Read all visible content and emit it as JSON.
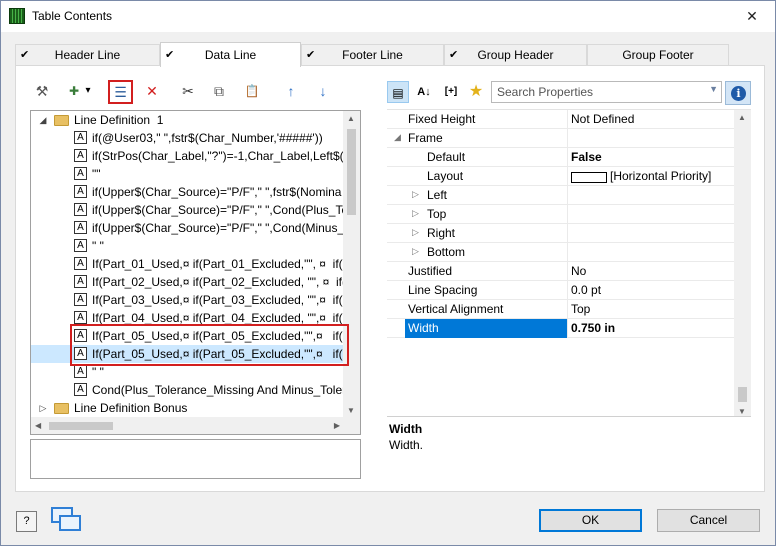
{
  "window": {
    "title": "Table Contents",
    "close_glyph": "✕"
  },
  "tabs": [
    {
      "label": "Header Line",
      "checked": true
    },
    {
      "label": "Data Line",
      "checked": true,
      "active": true
    },
    {
      "label": "Footer Line",
      "checked": true
    },
    {
      "label": "Group Header",
      "checked": true
    },
    {
      "label": "Group Footer",
      "checked": false
    }
  ],
  "check_glyph": "✔",
  "left_toolbar": [
    {
      "name": "wizard-icon",
      "glyph": "⚒"
    },
    {
      "name": "new-item-icon",
      "glyph": "✚"
    },
    {
      "name": "dropdown-arrow-icon",
      "glyph": "▾"
    },
    {
      "name": "edit-properties-icon",
      "glyph": "☰"
    },
    {
      "name": "delete-icon",
      "glyph": "✕"
    },
    {
      "name": "cut-icon",
      "glyph": "✂"
    },
    {
      "name": "copy-icon",
      "glyph": "⧉"
    },
    {
      "name": "paste-icon",
      "glyph": "📋"
    },
    {
      "name": "move-up-icon",
      "glyph": "↑"
    },
    {
      "name": "move-down-icon",
      "glyph": "↓"
    }
  ],
  "tree": {
    "items": [
      {
        "kind": "folder",
        "text": "Line Definition  1",
        "expanded": true
      },
      {
        "kind": "field",
        "text": "if(@User03,\" \",fstr$(Char_Number,'#####'))"
      },
      {
        "kind": "field",
        "text": "if(StrPos(Char_Label,\"?\")=-1,Char_Label,Left$(C"
      },
      {
        "kind": "field",
        "text": "\"\""
      },
      {
        "kind": "field",
        "text": "if(Upper$(Char_Source)=\"P/F\",\" \",fstr$(Nomina"
      },
      {
        "kind": "field",
        "text": "if(Upper$(Char_Source)=\"P/F\",\" \",Cond(Plus_To"
      },
      {
        "kind": "field",
        "text": "if(Upper$(Char_Source)=\"P/F\",\" \",Cond(Minus_"
      },
      {
        "kind": "field",
        "text": "\" \""
      },
      {
        "kind": "field",
        "text": "If(Part_01_Used,¤ if(Part_01_Excluded,\"\", ¤  if(Up"
      },
      {
        "kind": "field",
        "text": "If(Part_02_Used,¤ if(Part_02_Excluded, \"\", ¤  if(U"
      },
      {
        "kind": "field",
        "text": "If(Part_03_Used,¤ if(Part_03_Excluded, \"\",¤  if(U"
      },
      {
        "kind": "field",
        "text": "If(Part_04_Used,¤ if(Part_04_Excluded, \"\",¤  if(U"
      },
      {
        "kind": "field",
        "text": "If(Part_05_Used,¤ if(Part_05_Excluded,\"\",¤   if(Up"
      },
      {
        "kind": "field",
        "text": "If(Part_05_Used,¤ if(Part_05_Excluded,\"\",¤   if(Up",
        "selected": true
      },
      {
        "kind": "field",
        "text": "\" \""
      },
      {
        "kind": "field",
        "text": "Cond(Plus_Tolerance_Missing And Minus_Toler"
      },
      {
        "kind": "folder",
        "text": "Line Definition Bonus",
        "expanded": false
      }
    ],
    "expanded_glyph": "◢",
    "collapsed_glyph": "▷",
    "field_glyph": "A"
  },
  "right_toolbar": [
    {
      "name": "categorized-icon",
      "glyph": "▤"
    },
    {
      "name": "sort-alpha-icon",
      "glyph": "A↓"
    },
    {
      "name": "expand-all-icon",
      "glyph": "[+]"
    },
    {
      "name": "favorites-star-icon",
      "glyph": "★"
    }
  ],
  "search": {
    "placeholder": "Search Properties",
    "dropdown_glyph": "▼"
  },
  "info_glyph": "i",
  "properties": [
    {
      "name": "Fixed Height",
      "value": "Not Defined",
      "indent": 0
    },
    {
      "name": "Frame",
      "value": "",
      "indent": 0,
      "expander": "◢"
    },
    {
      "name": "Default",
      "value": "False",
      "indent": 1,
      "bold": true
    },
    {
      "name": "Layout",
      "value": "[Horizontal Priority]",
      "indent": 1,
      "swatch": true
    },
    {
      "name": "Left",
      "value": "",
      "indent": 1,
      "expander": "▷"
    },
    {
      "name": "Top",
      "value": "",
      "indent": 1,
      "expander": "▷"
    },
    {
      "name": "Right",
      "value": "",
      "indent": 1,
      "expander": "▷"
    },
    {
      "name": "Bottom",
      "value": "",
      "indent": 1,
      "expander": "▷"
    },
    {
      "name": "Justified",
      "value": "No",
      "indent": 0
    },
    {
      "name": "Line Spacing",
      "value": "0.0 pt",
      "indent": 0
    },
    {
      "name": "Vertical Alignment",
      "value": "Top",
      "indent": 0
    },
    {
      "name": "Width",
      "value": "0.750 in",
      "indent": 0,
      "selected": true,
      "bold": true
    }
  ],
  "description": {
    "title": "Width",
    "text": "Width."
  },
  "buttons": {
    "ok": "OK",
    "cancel": "Cancel",
    "help": "?"
  },
  "scroll_glyphs": {
    "up": "▲",
    "down": "▼",
    "left": "◀",
    "right": "▶"
  }
}
